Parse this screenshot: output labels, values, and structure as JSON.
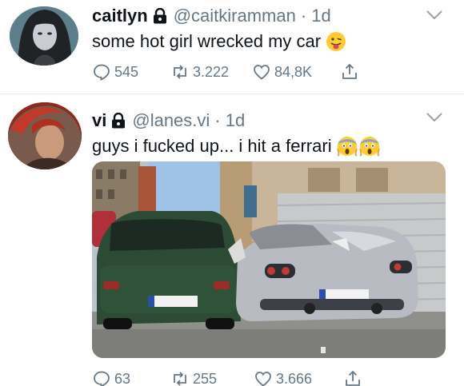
{
  "tweets": [
    {
      "display_name": "caitlyn",
      "handle": "@caitkiramman",
      "time": "· 1d",
      "text": "some hot girl wrecked my car",
      "emojis": [
        "face-with-tongue"
      ],
      "replies": "545",
      "retweets": "3.222",
      "likes": "84,8K"
    },
    {
      "display_name": "vi",
      "handle": "@lanes.vi",
      "time": "· 1d",
      "text": "guys i fucked up... i hit a ferrari",
      "emojis": [
        "face-screaming-in-fear",
        "face-screaming-in-fear"
      ],
      "media": "photo of a green hatchback crashed into a silver sports car",
      "replies": "63",
      "retweets": "255",
      "likes": "3.666"
    }
  ],
  "colors": {
    "text": "#0f1419",
    "secondary": "#657786",
    "divider": "#e6ecf0"
  },
  "icons": [
    "lock-icon",
    "chevron-down-icon",
    "reply-icon",
    "retweet-icon",
    "like-icon",
    "share-icon"
  ]
}
